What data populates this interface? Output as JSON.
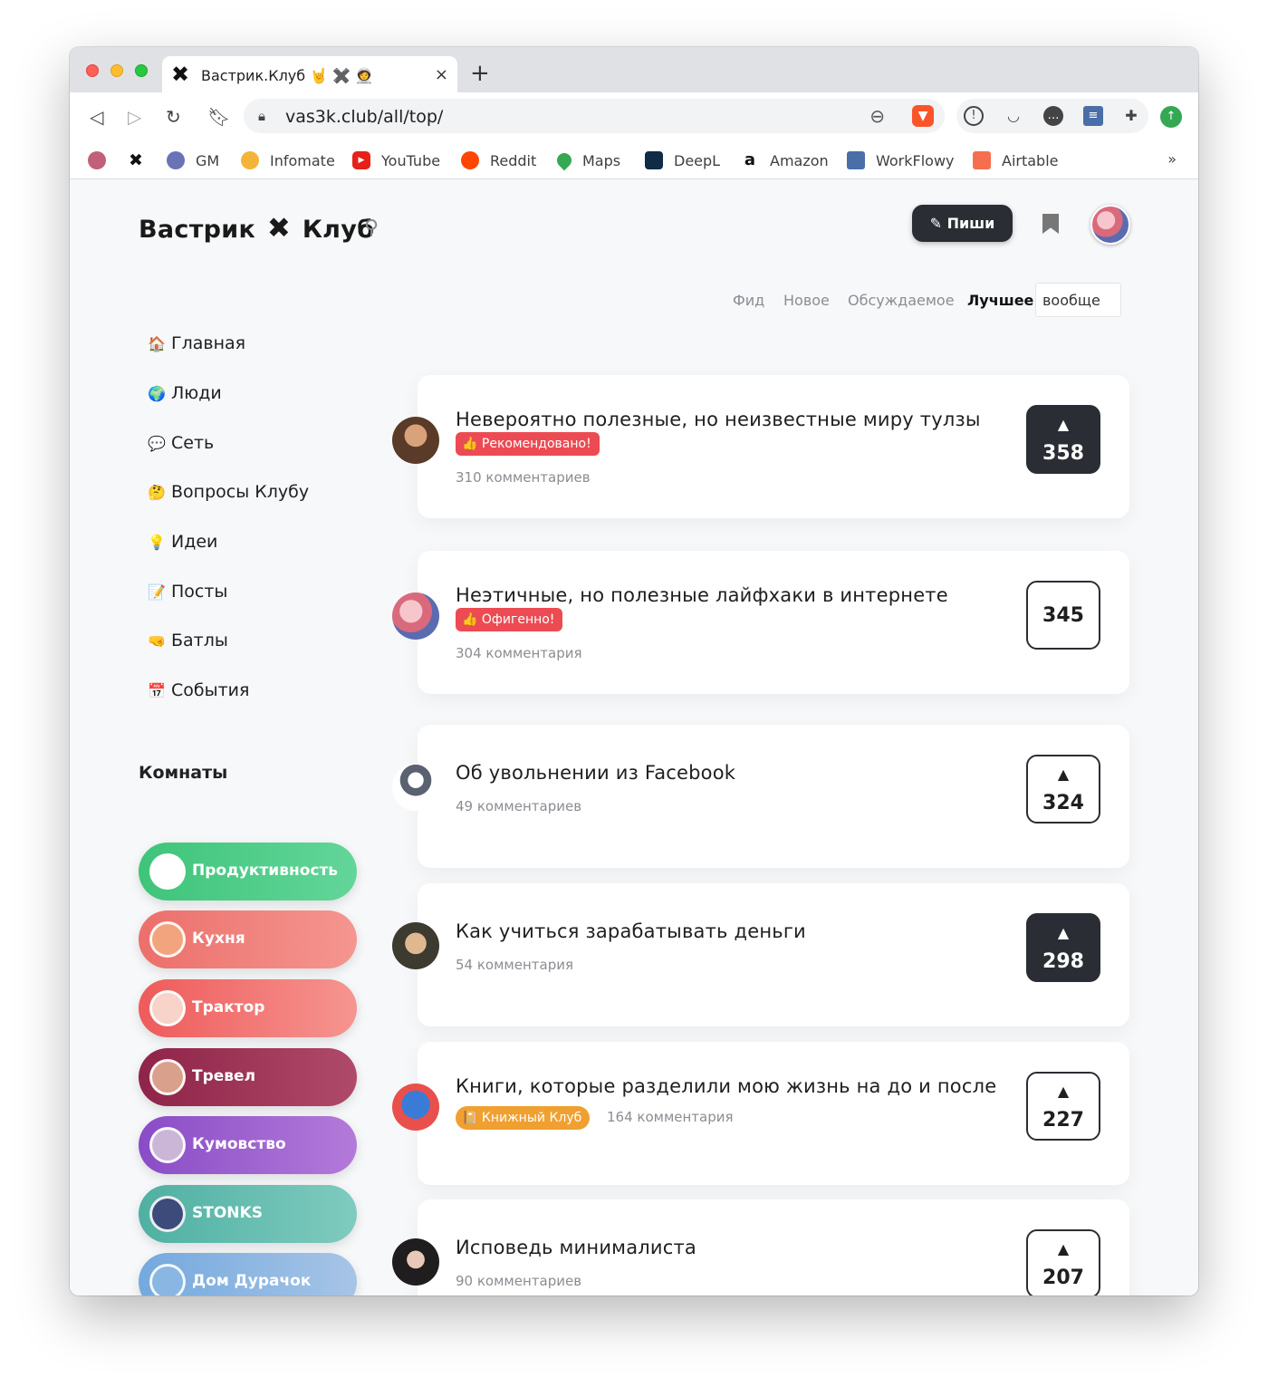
{
  "browser": {
    "tab_title": "Вастрик.Клуб 🤘 ✖️ 🧑‍🚀",
    "tab_close": "×",
    "new_tab": "+",
    "url": "vas3k.club/all/top/",
    "bookmarks": [
      {
        "label": "",
        "icon": "profile-avatar",
        "color": "#c0607a"
      },
      {
        "label": "",
        "icon": "x-logo",
        "color": "#111111"
      },
      {
        "label": "GM",
        "icon": "gm-avatar",
        "color": "#6a73b5"
      },
      {
        "label": "Infomate",
        "icon": "infomate-icon",
        "color": "#f4b43a"
      },
      {
        "label": "YouTube",
        "icon": "youtube-icon",
        "color": "#e62117"
      },
      {
        "label": "Reddit",
        "icon": "reddit-icon",
        "color": "#ff4500"
      },
      {
        "label": "Maps",
        "icon": "maps-pin-icon",
        "color": "#34a853"
      },
      {
        "label": "DeepL",
        "icon": "deepl-icon",
        "color": "#0f2b46"
      },
      {
        "label": "Amazon",
        "icon": "amazon-icon",
        "color": "#222222"
      },
      {
        "label": "WorkFlowy",
        "icon": "workflowy-icon",
        "color": "#4a6fa8"
      },
      {
        "label": "Airtable",
        "icon": "airtable-icon",
        "color": "#f56f4f"
      }
    ],
    "bookmarks_more": "»"
  },
  "site": {
    "logo_left": "Вастрик",
    "logo_mark": "✖",
    "logo_right": "Клуб",
    "write_button": "Пиши"
  },
  "filters": {
    "items": [
      "Фид",
      "Новое",
      "Обсуждаемое",
      "Лучшее"
    ],
    "active": "Лучшее",
    "period": "вообще"
  },
  "menu": [
    {
      "emoji": "🏠",
      "label": "Главная"
    },
    {
      "emoji": "🌍",
      "label": "Люди"
    },
    {
      "emoji": "💬",
      "label": "Сеть"
    },
    {
      "emoji": "🤔",
      "label": "Вопросы Клубу"
    },
    {
      "emoji": "💡",
      "label": "Идеи"
    },
    {
      "emoji": "📝",
      "label": "Посты"
    },
    {
      "emoji": "🤜",
      "label": "Батлы"
    },
    {
      "emoji": "📅",
      "label": "События"
    }
  ],
  "rooms_title": "Комнаты",
  "rooms": [
    {
      "label": "Продуктивность",
      "from": "#3fc47a",
      "to": "#62d699"
    },
    {
      "label": "Кухня",
      "from": "#ec6f6b",
      "to": "#f59690"
    },
    {
      "label": "Трактор",
      "from": "#ee5b5b",
      "to": "#f69590"
    },
    {
      "label": "Тревел",
      "from": "#8e2448",
      "to": "#b04a6a"
    },
    {
      "label": "Кумовство",
      "from": "#8a4cc7",
      "to": "#b47ad9"
    },
    {
      "label": "STONKS",
      "from": "#4fb0a2",
      "to": "#7fcbbf"
    },
    {
      "label": "Дом Дурачок",
      "from": "#74a9de",
      "to": "#a7c4e6"
    },
    {
      "label": "",
      "from": "#e99a34",
      "to": "#f2b860"
    }
  ],
  "posts": [
    {
      "title": "Невероятно полезные, но неизвестные миру тулзы",
      "badge": "👍 Рекомендовано!",
      "badge_style": "red",
      "comments": "310 комментариев",
      "votes": "358",
      "vote_style": "dark",
      "arrow": "▲"
    },
    {
      "title": "Неэтичные, но полезные лайфхаки в интернете",
      "badge": "👍 Офигенно!",
      "badge_style": "red",
      "comments": "304 комментария",
      "votes": "345",
      "vote_style": "light",
      "arrow": ""
    },
    {
      "title": "Об увольнении из Facebook",
      "badge": "",
      "badge_style": "",
      "comments": "49 комментариев",
      "votes": "324",
      "vote_style": "light",
      "arrow": "▲"
    },
    {
      "title": "Как учиться зарабатывать деньги",
      "badge": "",
      "badge_style": "",
      "comments": "54 комментария",
      "votes": "298",
      "vote_style": "dark",
      "arrow": "▲"
    },
    {
      "title": "Книги, которые разделили мою жизнь на до и после",
      "badge": "📔 Книжный Клуб",
      "badge_style": "orange",
      "comments": "164 комментария",
      "votes": "227",
      "vote_style": "light",
      "arrow": "▲"
    },
    {
      "title": "Исповедь минималиста",
      "badge": "",
      "badge_style": "",
      "comments": "90 комментариев",
      "votes": "207",
      "vote_style": "light",
      "arrow": "▲"
    }
  ]
}
